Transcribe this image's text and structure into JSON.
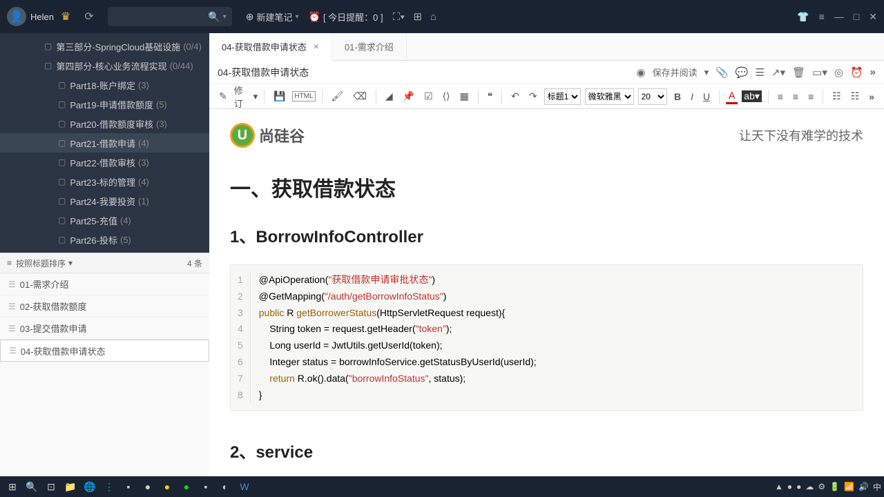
{
  "titlebar": {
    "username": "Helen",
    "newNote": "新建笔记",
    "reminder": "[ 今日提醒：0 ]"
  },
  "sidebar": {
    "tree": [
      {
        "type": "folder",
        "label": "第三部分-SpringCloud基础设施",
        "count": "(0/4)"
      },
      {
        "type": "folder",
        "label": "第四部分-核心业务流程实现",
        "count": "(0/44)"
      },
      {
        "type": "sub",
        "label": "Part18-账户绑定",
        "count": "(3)"
      },
      {
        "type": "sub",
        "label": "Part19-申请借款额度",
        "count": "(5)"
      },
      {
        "type": "sub",
        "label": "Part20-借款额度审核",
        "count": "(3)"
      },
      {
        "type": "sub",
        "label": "Part21-借款申请",
        "count": "(4)",
        "selected": true
      },
      {
        "type": "sub",
        "label": "Part22-借款审核",
        "count": "(3)"
      },
      {
        "type": "sub",
        "label": "Part23-标的管理",
        "count": "(4)"
      },
      {
        "type": "sub",
        "label": "Part24-我要投资",
        "count": "(1)"
      },
      {
        "type": "sub",
        "label": "Part25-充值",
        "count": "(4)"
      },
      {
        "type": "sub",
        "label": "Part26-投标",
        "count": "(5)"
      }
    ],
    "sortLabel": "按照标题排序",
    "noteCount": "4 条",
    "notes": [
      {
        "label": "01-需求介绍"
      },
      {
        "label": "02-获取借款额度"
      },
      {
        "label": "03-提交借款申请"
      },
      {
        "label": "04-获取借款申请状态",
        "selected": true
      }
    ]
  },
  "tabs": [
    {
      "label": "04-获取借款申请状态",
      "active": true,
      "closeable": true
    },
    {
      "label": "01-需求介绍",
      "active": false
    }
  ],
  "doc": {
    "title": "04-获取借款申请状态",
    "saveRead": "保存并阅读",
    "modify": "修订",
    "heading": "标题1",
    "font": "微软雅黑",
    "size": "20"
  },
  "brand": {
    "name": "尚硅谷",
    "slogan": "让天下没有难学的技术"
  },
  "content": {
    "h1": "一、获取借款状态",
    "h2a": "1、BorrowInfoController",
    "h2b": "2、service",
    "code": {
      "l1a": "@ApiOperation(",
      "l1b": "\"获取借款申请审批状态\"",
      "l1c": ")",
      "l2a": "@GetMapping(",
      "l2b": "\"/auth/getBorrowInfoStatus\"",
      "l2c": ")",
      "l3a": "public",
      "l3b": " R ",
      "l3c": "getBorrowerStatus",
      "l3d": "(HttpServletRequest request){",
      "l4": "    String token = request.getHeader(",
      "l4b": "\"token\"",
      "l4c": ");",
      "l5": "    Long userId = JwtUtils.getUserId(token);",
      "l6": "    Integer status = borrowInfoService.getStatusByUserId(userId);",
      "l7a": "    ",
      "l7b": "return",
      "l7c": " R.ok().data(",
      "l7d": "\"borrowInfoStatus\"",
      "l7e": ", status);",
      "l8": "}"
    }
  },
  "tray": {
    "ime": "中"
  }
}
